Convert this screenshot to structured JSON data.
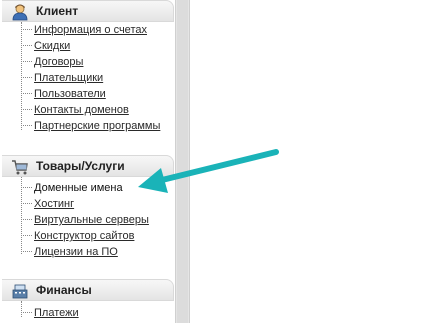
{
  "sections": [
    {
      "title": "Клиент",
      "icon": "user-icon",
      "items": [
        "Информация о счетах",
        "Скидки",
        "Договоры",
        "Плательщики",
        "Пользователи",
        "Контакты доменов",
        "Партнерские программы"
      ]
    },
    {
      "title": "Товары/Услуги",
      "icon": "shopping-cart-icon",
      "items": [
        "Доменные имена",
        "Хостинг",
        "Виртуальные серверы",
        "Конструктор сайтов",
        "Лицензии на ПО"
      ],
      "active_item": "Доменные имена"
    },
    {
      "title": "Финансы",
      "icon": "cash-register-icon",
      "items": [
        "Платежи"
      ]
    }
  ],
  "annotation": {
    "type": "arrow",
    "color": "#1ab3b8",
    "points_to": "Доменные имена"
  }
}
